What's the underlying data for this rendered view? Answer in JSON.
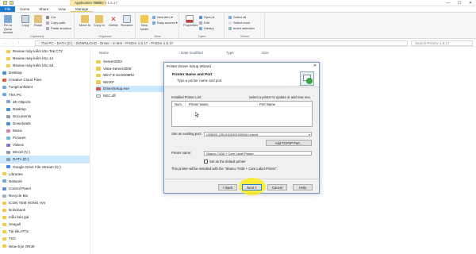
{
  "titlebar": {
    "app_tag": "Application Tools",
    "window_title": "PrnDrv-1.6.17",
    "minimize": "—",
    "maximize": "☐",
    "close": "✕"
  },
  "tabs": [
    {
      "label": "File"
    },
    {
      "label": "Home"
    },
    {
      "label": "Share"
    },
    {
      "label": "View"
    },
    {
      "label": "Manage"
    }
  ],
  "ribbon": {
    "clipboard": {
      "pin_label": "Pin to Quick access",
      "copy_label": "Copy",
      "paste_label": "Paste",
      "cut_label": "Cut",
      "copy_path_label": "Copy path",
      "paste_shortcut_label": "Paste shortcut",
      "group_label": "Clipboard"
    },
    "organize": {
      "move_to_label": "Move to",
      "copy_to_label": "Copy to",
      "delete_label": "Delete",
      "rename_label": "Rename",
      "group_label": "Organize"
    },
    "new": {
      "new_folder_label": "New folder",
      "new_item_label": "New item",
      "easy_access_label": "Easy access",
      "group_label": "New"
    },
    "open": {
      "properties_label": "Properties",
      "open_label": "Open",
      "edit_label": "Edit",
      "history_label": "History",
      "group_label": "Open"
    },
    "select": {
      "select_all_label": "Select all",
      "select_none_label": "Select none",
      "invert_label": "Invert selection",
      "group_label": "Select"
    }
  },
  "address": {
    "back": "←",
    "forward": "→",
    "up": "↑",
    "path": "›  This PC  ›  DATA (D:)  ›  DOWNLOAD  ›  Driver  ›  in tem  ›  PrnDrv-1.6.17  ›  PrnDrv-1.6.17",
    "search_placeholder": "Search PrnDrv-1.6.17"
  },
  "navpane": {
    "items": [
      {
        "label": "Review máy kiểm kho Tek C72"
      },
      {
        "label": "Review máy kiểm kho 14"
      },
      {
        "label": "Review máy kiểm kho S4"
      },
      {
        "label": "Desktop"
      },
      {
        "label": "Creative Cloud Files"
      },
      {
        "label": "TungConfident"
      },
      {
        "label": "This PC"
      },
      {
        "label": "3D Objects"
      },
      {
        "label": "Desktop"
      },
      {
        "label": "Documents"
      },
      {
        "label": "Downloads"
      },
      {
        "label": "Music"
      },
      {
        "label": "Pictures"
      },
      {
        "label": "Videos"
      },
      {
        "label": "Win10 (C:)"
      },
      {
        "label": "DATA (D:)"
      },
      {
        "label": "Google Drive File Stream (G:)"
      },
      {
        "label": "Libraries"
      },
      {
        "label": "Network"
      },
      {
        "label": "Control Panel"
      },
      {
        "label": "Recycle Bin"
      },
      {
        "label": "ICON TEM HONG HAI"
      },
      {
        "label": "kinhdoanh"
      },
      {
        "label": "mẫu báo giá"
      },
      {
        "label": "Seagull"
      },
      {
        "label": "Tài liệu PTS"
      },
      {
        "label": "TSC"
      },
      {
        "label": "Wow Eye ON39"
      }
    ]
  },
  "columns": {
    "name": "Name",
    "date": "Date modified",
    "type": "Type",
    "size": "Size"
  },
  "files": [
    {
      "name": "Server2003"
    },
    {
      "name": "Vista-Server2008"
    },
    {
      "name": "Win7-8-Svr2008R2"
    },
    {
      "name": "WinXP"
    },
    {
      "name": "DriverSetup.exe"
    },
    {
      "name": "NEC.dll"
    }
  ],
  "dialog": {
    "title": "Printer Driver Setup Wizard",
    "close": "✕",
    "header_title": "Printer Name and Port",
    "header_subtitle": "Type a printer name and port.",
    "installed_list_label": "Installed Printer List:",
    "list_hint": "Select a printer to update or add new one.",
    "col_num": "Num.",
    "col_printer_name": "Printer Name",
    "col_port_name": "Port Name",
    "existing_port_label": "Use an existing port:",
    "existing_port_value": "USB001 (SN:01019010000#) Linked",
    "add_port_button": "Add TCP/IP Port...",
    "printer_name_label": "Printer name:",
    "printer_name_value": "Sbarco T438 + Care Label Printer",
    "default_printer_label": "Set as the default printer",
    "install_note": "This printer will be installed with the \"Sbarco T438 + Care Label Printer\".",
    "back_button": "< Back",
    "next_button": "Next >",
    "cancel_button": "Cancel",
    "help_button": "Help"
  },
  "colors": {
    "accent": "#1979ca",
    "selection": "#cce8ff",
    "highlight": "#ffee00"
  }
}
